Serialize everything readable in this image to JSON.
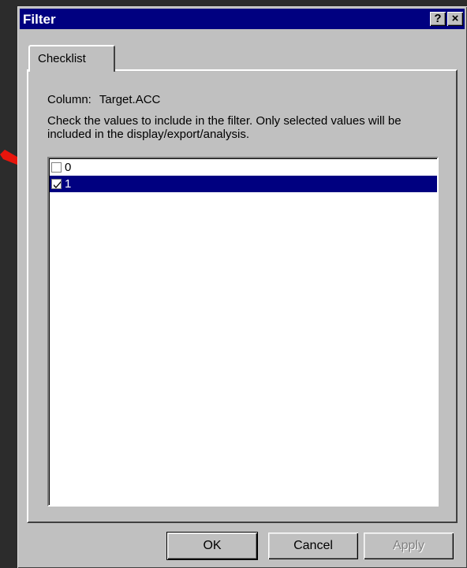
{
  "dialog": {
    "title": "Filter",
    "help_glyph": "?",
    "close_glyph": "×"
  },
  "tabs": [
    {
      "label": "Checklist",
      "active": true
    }
  ],
  "checklist": {
    "column_label": "Column:",
    "column_value": "Target.ACC",
    "instructions": "Check the values to include in the filter.  Only selected values will be included in the display/export/analysis.",
    "items": [
      {
        "label": "0",
        "checked": false,
        "selected": false
      },
      {
        "label": "1",
        "checked": true,
        "selected": true
      }
    ]
  },
  "buttons": {
    "ok": "OK",
    "cancel": "Cancel",
    "apply": "Apply"
  },
  "colors": {
    "titlebar": "#000080",
    "selection": "#000080",
    "annotation_arrow": "#e8150c"
  }
}
